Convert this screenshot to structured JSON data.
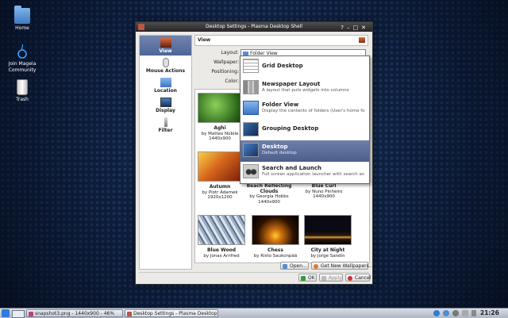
{
  "desktop": {
    "icons": [
      {
        "label": "Home",
        "icon": "folder-icon"
      },
      {
        "label": "Join Mageia Community",
        "icon": "mageia-icon"
      },
      {
        "label": "Trash",
        "icon": "trash-icon"
      }
    ]
  },
  "dialog": {
    "title": "Desktop Settings - Plasma Desktop Shell",
    "sidebar": [
      {
        "label": "View",
        "active": true
      },
      {
        "label": "Mouse Actions",
        "active": false
      },
      {
        "label": "Location",
        "active": false
      },
      {
        "label": "Display",
        "active": false
      },
      {
        "label": "Filter",
        "active": false
      }
    ],
    "header": "View",
    "form": {
      "layout_label": "Layout:",
      "layout_value": "Folder View",
      "wallpaper_label": "Wallpaper:",
      "positioning_label": "Positioning:",
      "color_label": "Color:"
    },
    "wallpapers": [
      {
        "name": "Aghi",
        "author": "by Matteo Nobile",
        "size": "1440x900"
      },
      {
        "name": "Autumn",
        "author": "by Piotr Adamek",
        "size": "1920x1200"
      },
      {
        "name": "Beach Reflecting Clouds",
        "author": "by Georgia Hobbs",
        "size": "1440x900"
      },
      {
        "name": "Blue Curl",
        "author": "by Nuno Pinheiro",
        "size": "1440x900"
      },
      {
        "name": "Blue Wood",
        "author": "by Jonas Arnfred",
        "size": ""
      },
      {
        "name": "Chess",
        "author": "by Risto Saukonpää",
        "size": ""
      },
      {
        "name": "City at Night",
        "author": "by Jorge Sandín",
        "size": ""
      }
    ],
    "buttons": {
      "open": "Open...",
      "get_new": "Get New Wallpapers...",
      "ok": "OK",
      "apply": "Apply",
      "cancel": "Cancel"
    },
    "layout_options": [
      {
        "title": "Grid Desktop",
        "desc": "",
        "icon": "grid-icon"
      },
      {
        "title": "Newspaper Layout",
        "desc": "A layout that puts widgets into columns",
        "icon": "newspaper-icon"
      },
      {
        "title": "Folder View",
        "desc": "Display the contents of folders (User's home fo",
        "icon": "folder-icon"
      },
      {
        "title": "Grouping Desktop",
        "desc": "",
        "icon": "grouping-icon"
      },
      {
        "title": "Desktop",
        "desc": "Default desktop",
        "icon": "desktop-icon",
        "selected": true
      },
      {
        "title": "Search and Launch",
        "desc": "Full screen application launcher with search an",
        "icon": "binoculars-icon"
      }
    ]
  },
  "taskbar": {
    "tasks": [
      {
        "label": "snapshot3.png - 1440x900 - 46%",
        "active": false
      },
      {
        "label": "Desktop Settings - Plasma Desktop",
        "active": true
      }
    ],
    "clock": "21:26"
  }
}
